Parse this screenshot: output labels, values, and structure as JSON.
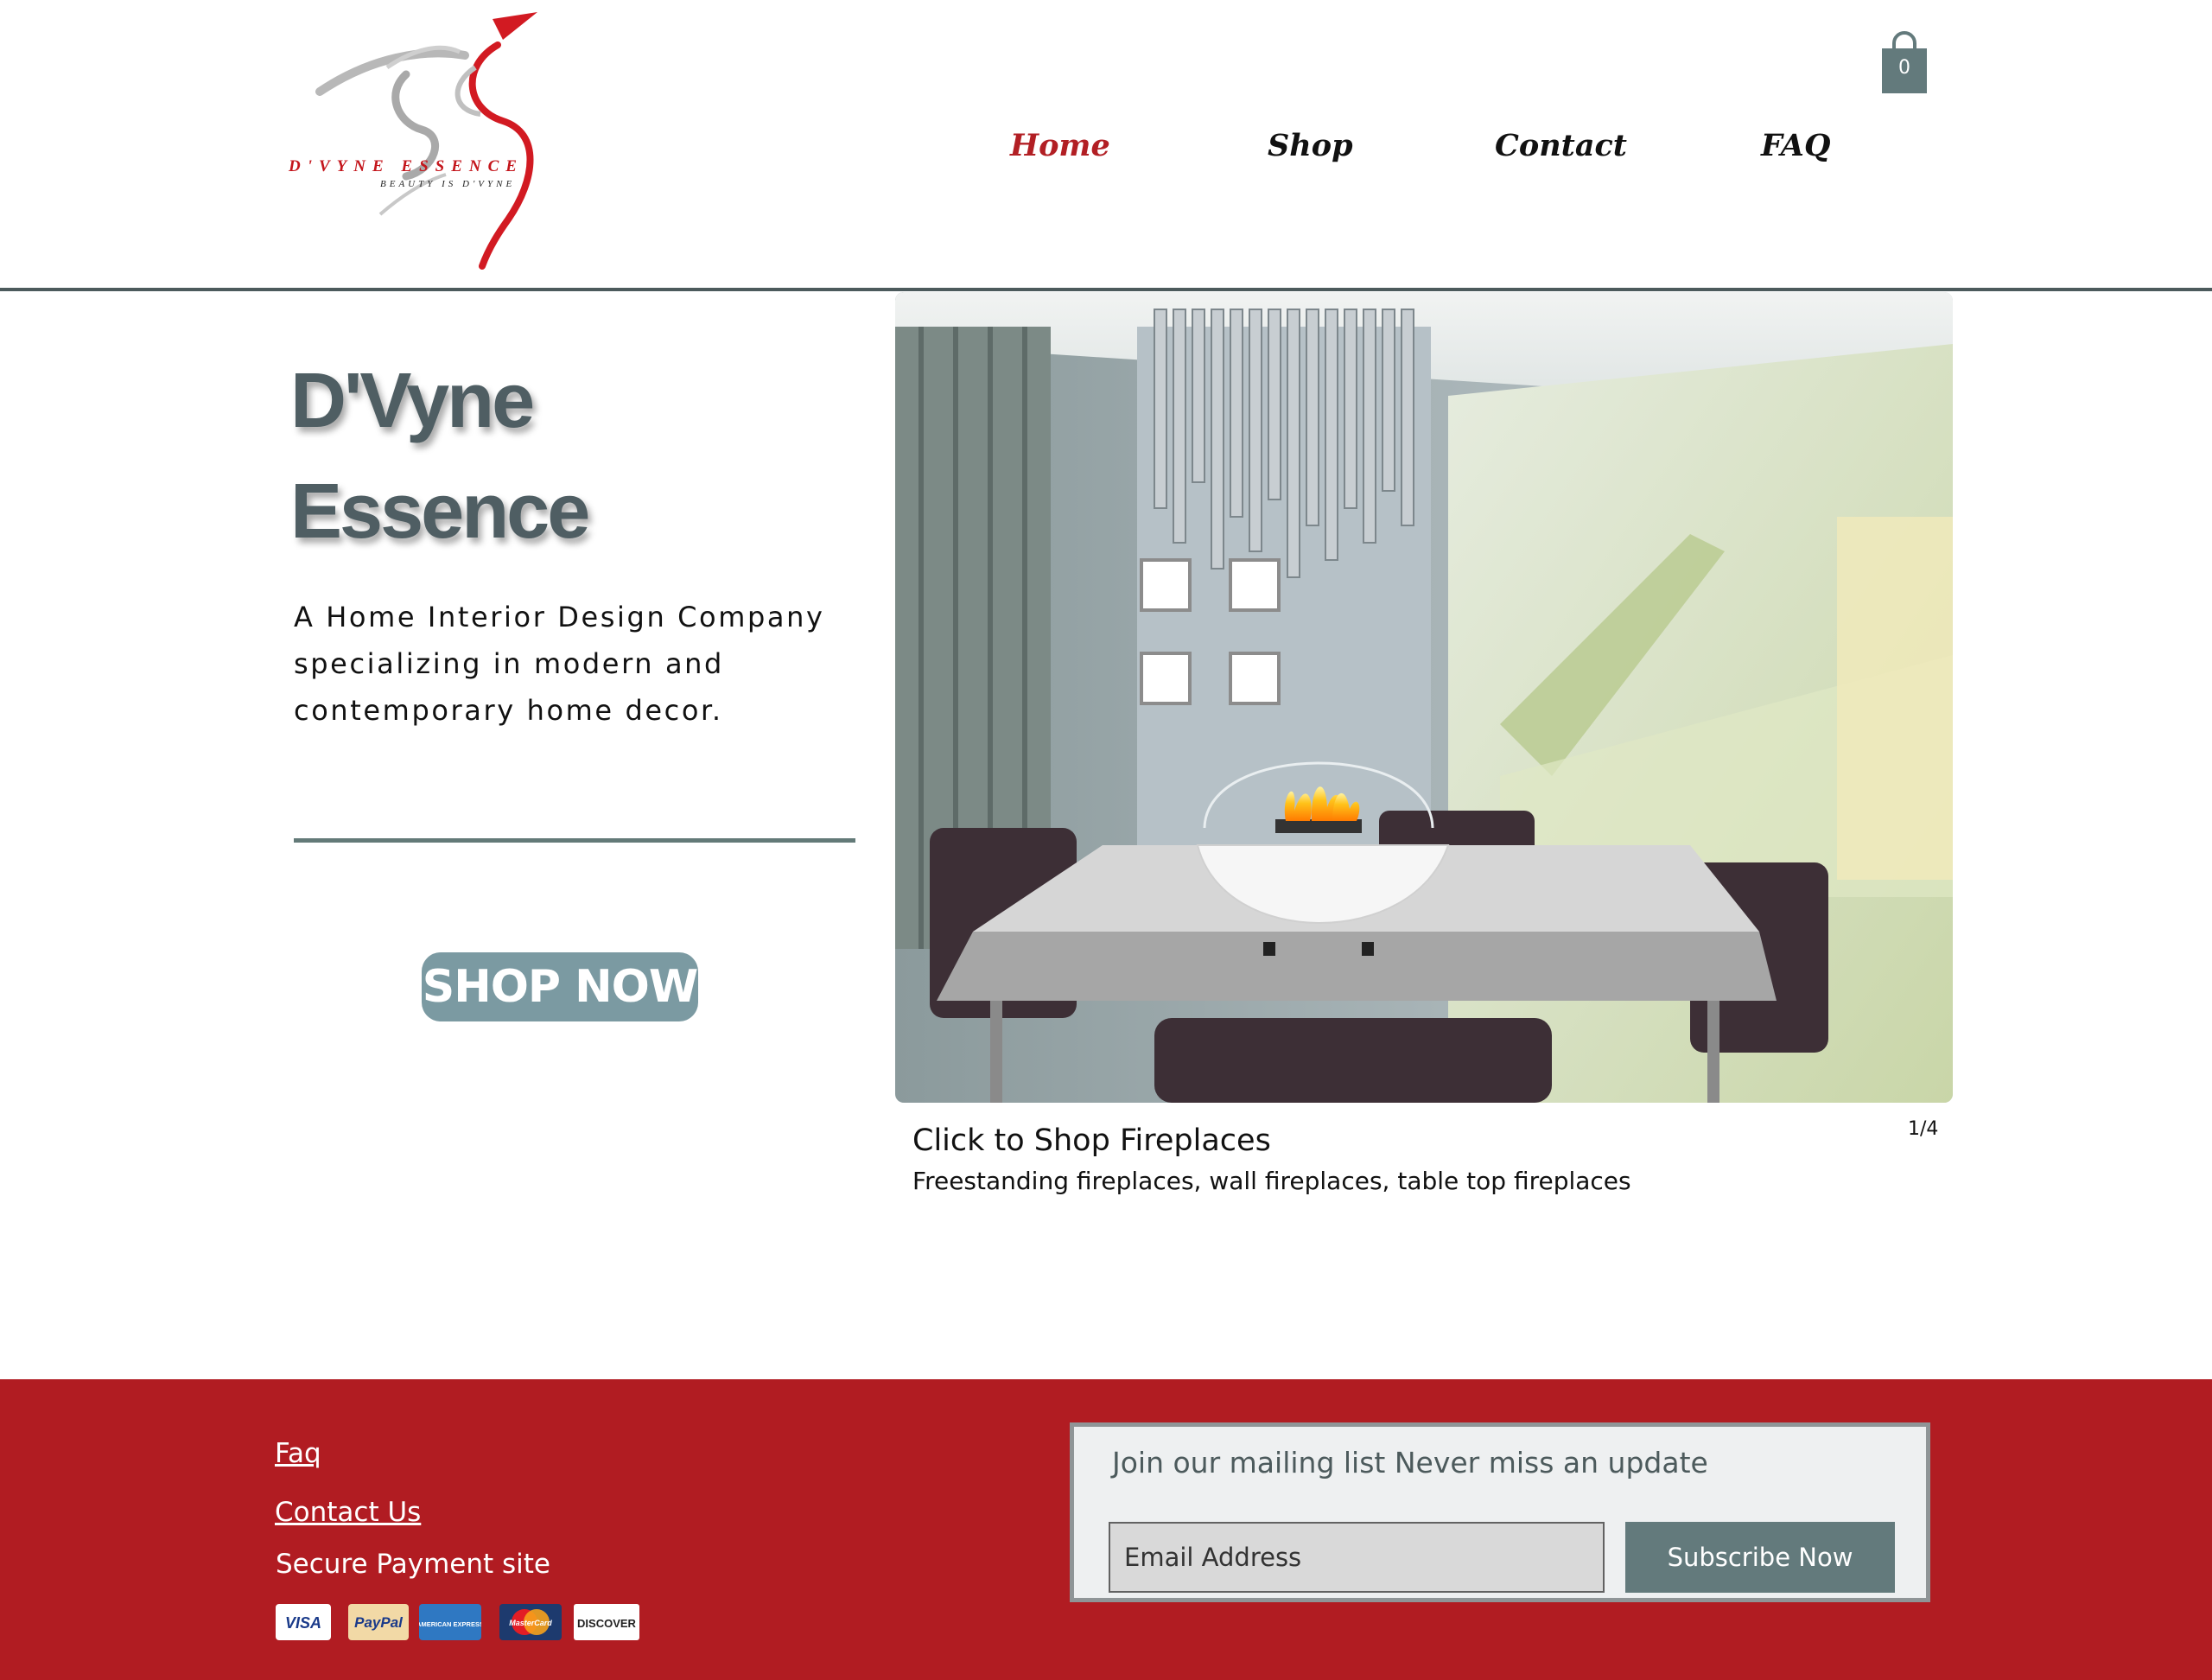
{
  "logo": {
    "brand": "D'VYNE ESSENCE",
    "tagline": "BEAUTY IS D'VYNE"
  },
  "cart": {
    "count": "0",
    "icon": "shopping-bag-icon"
  },
  "nav": {
    "items": [
      {
        "label": "Home",
        "active": true
      },
      {
        "label": "Shop",
        "active": false
      },
      {
        "label": "Contact",
        "active": false
      },
      {
        "label": "FAQ",
        "active": false
      }
    ]
  },
  "hero": {
    "title_line1": "D'Vyne",
    "title_line2": "Essence",
    "description": "A Home Interior Design Company specializing in modern and contemporary home decor.",
    "cta_label": "SHOP NOW"
  },
  "slider": {
    "title": "Click to Shop Fireplaces",
    "subtitle": "Freestanding fireplaces, wall fireplaces, table top fireplaces",
    "counter": "1/4"
  },
  "footer": {
    "links": [
      {
        "label": "Faq"
      },
      {
        "label": "Contact Us"
      }
    ],
    "secure_text": "Secure Payment site",
    "payment_cards": [
      "VISA",
      "PayPal",
      "AMERICAN EXPRESS",
      "MasterCard",
      "DISCOVER"
    ],
    "mailing": {
      "title": "Join our mailing list Never miss an update",
      "email_placeholder": "Email Address",
      "button_label": "Subscribe Now"
    }
  },
  "colors": {
    "accent_red": "#b21f24",
    "footer_red": "#b11c22",
    "slate": "#4f5e63",
    "teal_gray": "#7b9aa2"
  }
}
